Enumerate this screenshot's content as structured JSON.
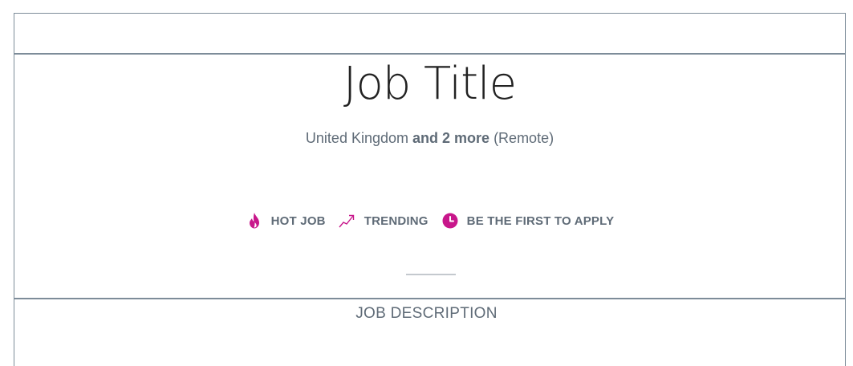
{
  "header": {
    "title": "Job Title",
    "location": "United Kingdom",
    "more_locations": "and 2 more",
    "work_type": "(Remote)"
  },
  "badges": [
    {
      "label": "HOT JOB",
      "icon": "flame-icon"
    },
    {
      "label": "TRENDING",
      "icon": "trending-up-icon"
    },
    {
      "label": "BE THE FIRST TO APPLY",
      "icon": "clock-icon"
    }
  ],
  "sections": {
    "description_heading": "JOB DESCRIPTION"
  },
  "colors": {
    "accent": "#c8178b",
    "text": "#5f6b77",
    "title": "#222222",
    "border": "#7d8c99"
  }
}
